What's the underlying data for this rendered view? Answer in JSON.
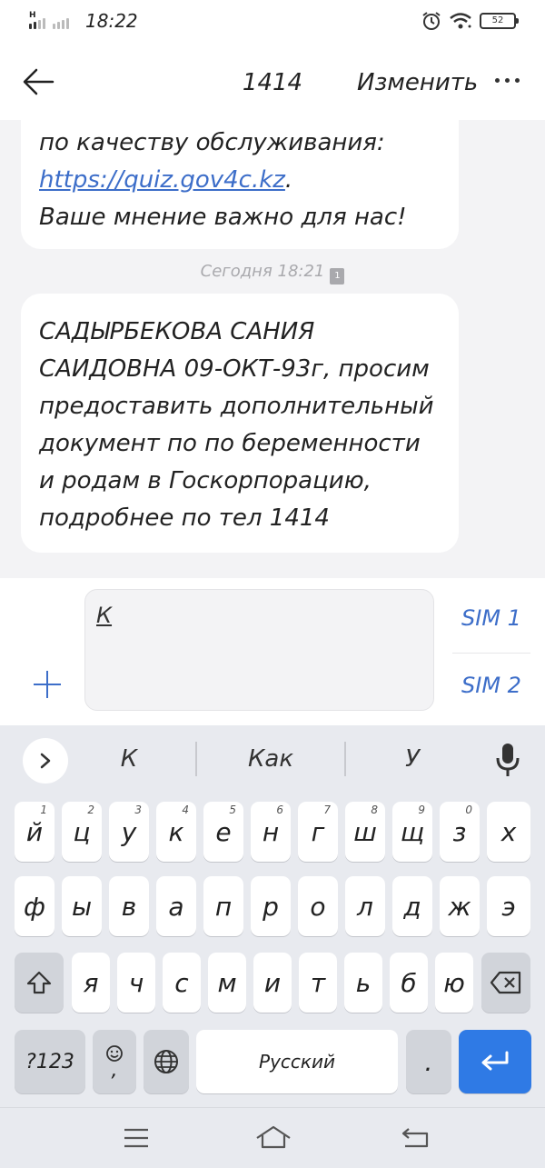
{
  "status": {
    "time": "18:22",
    "signal_label": "H",
    "battery": "52"
  },
  "header": {
    "title": "1414",
    "edit_label": "Изменить"
  },
  "messages": {
    "first": {
      "line1": "по качеству обслуживания:",
      "link": "https://quiz.gov4c.kz",
      "link_suffix": ".",
      "line3": "Ваше мнение важно для нас!"
    },
    "date_label": "Сегодня 18:21",
    "sim_badge": "1",
    "second": {
      "lines": [
        "САДЫРБЕКОВА САНИЯ",
        "САИДОВНА 09-ОКТ-93г, просим",
        "предоставить дополнительный",
        "документ по по беременности",
        "и родам в Госкорпорацию,",
        "подробнее по тел 1414"
      ]
    }
  },
  "compose": {
    "input_value": "К",
    "sim1_label": "SIM 1",
    "sim2_label": "SIM 2"
  },
  "keyboard": {
    "suggestions": [
      "К",
      "Как",
      "У"
    ],
    "row1": [
      {
        "label": "й",
        "num": "1"
      },
      {
        "label": "ц",
        "num": "2"
      },
      {
        "label": "у",
        "num": "3"
      },
      {
        "label": "к",
        "num": "4"
      },
      {
        "label": "е",
        "num": "5"
      },
      {
        "label": "н",
        "num": "6"
      },
      {
        "label": "г",
        "num": "7"
      },
      {
        "label": "ш",
        "num": "8"
      },
      {
        "label": "щ",
        "num": "9"
      },
      {
        "label": "з",
        "num": "0"
      },
      {
        "label": "х",
        "num": ""
      }
    ],
    "row2": [
      "ф",
      "ы",
      "в",
      "а",
      "п",
      "р",
      "о",
      "л",
      "д",
      "ж",
      "э"
    ],
    "row3": [
      "я",
      "ч",
      "с",
      "м",
      "и",
      "т",
      "ь",
      "б",
      "ю"
    ],
    "symbols_label": "?123",
    "emoji_comma": ",",
    "space_label": "Русский",
    "period_label": "."
  },
  "colors": {
    "accent": "#3d6ec9",
    "enter": "#2f7ae5",
    "keyboard_bg": "#e8eaef"
  },
  "icons": {
    "back": "arrow-left-icon",
    "more": "more-dots-icon",
    "alarm": "alarm-icon",
    "wifi": "wifi-icon",
    "battery": "battery-icon",
    "plus": "plus-icon",
    "expand": "chevron-right-icon",
    "mic": "mic-icon",
    "shift": "shift-icon",
    "backspace": "backspace-icon",
    "emoji": "emoji-icon",
    "globe": "globe-icon",
    "enter": "enter-icon",
    "nav_menu": "menu-icon",
    "nav_home": "home-icon",
    "nav_back": "back-icon"
  }
}
